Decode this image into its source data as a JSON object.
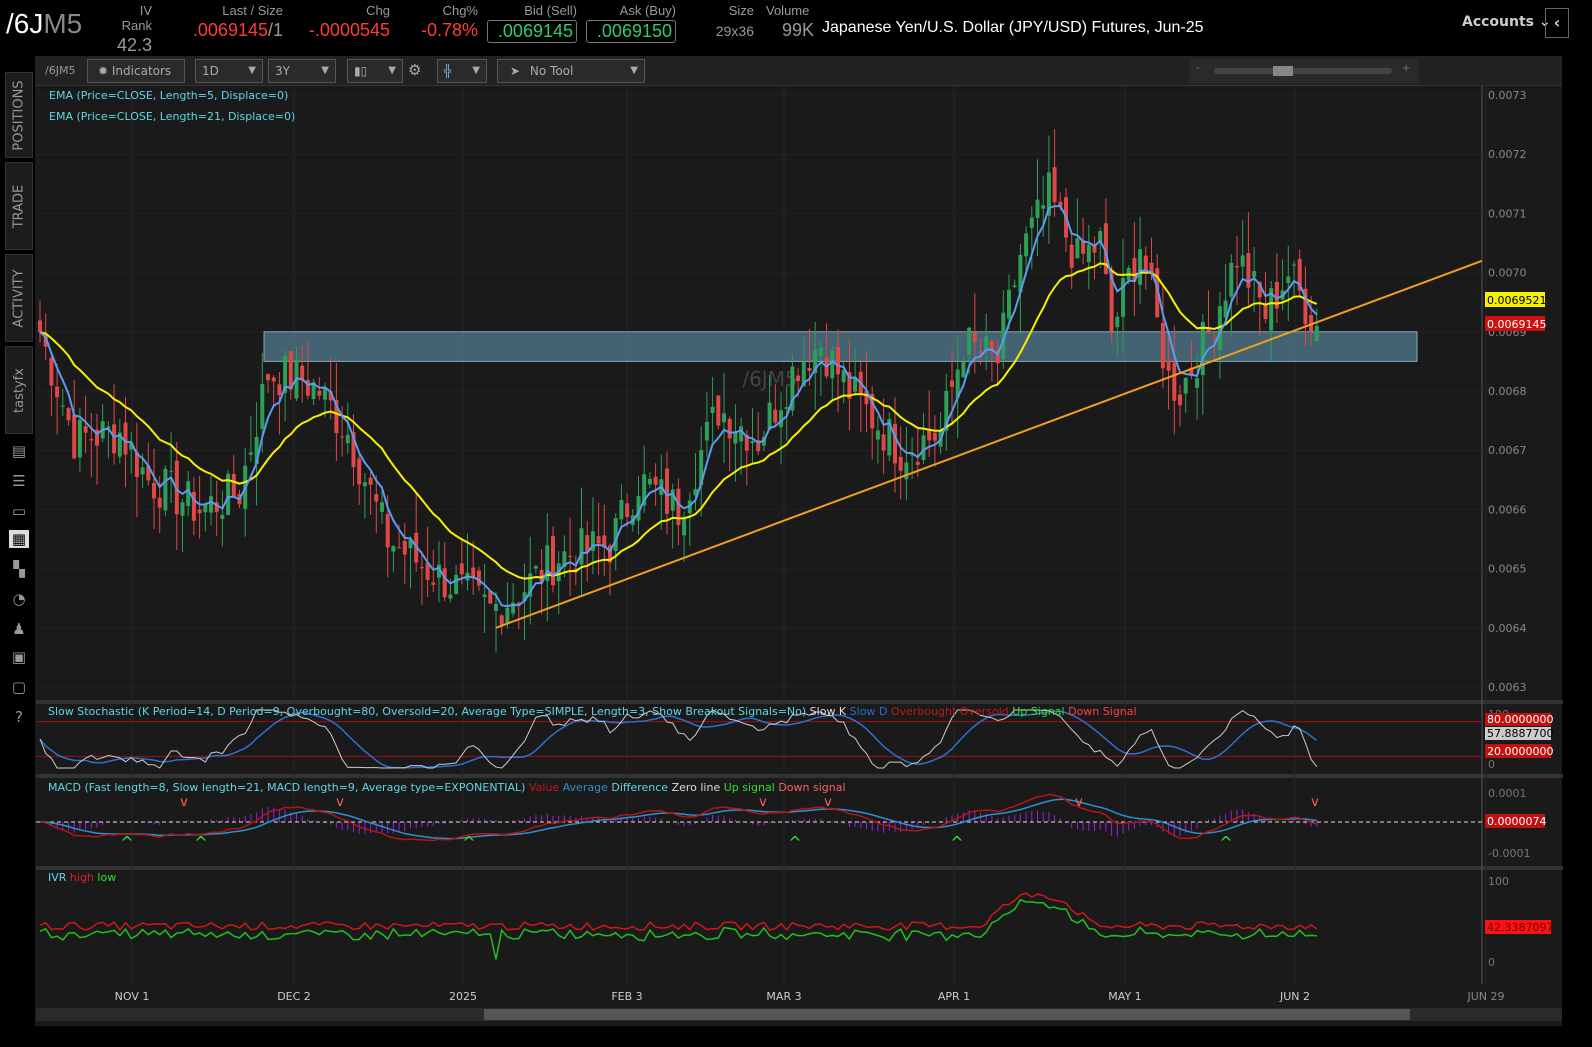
{
  "header": {
    "symbol_main": "/6J",
    "symbol_dim": "M5",
    "iv_rank": {
      "label": "IV Rank",
      "value": "42.3"
    },
    "last": {
      "label": "Last / Size",
      "value": ".0069145",
      "size": "/1"
    },
    "chg": {
      "label": "Chg",
      "value": "-.0000545"
    },
    "chgp": {
      "label": "Chg%",
      "value": "-0.78%"
    },
    "bid": {
      "label": "Bid (Sell)",
      "value": ".0069145"
    },
    "ask": {
      "label": "Ask (Buy)",
      "value": ".0069150"
    },
    "size": {
      "label": "Size",
      "value": "29x36"
    },
    "volume": {
      "label": "Volume",
      "value": "99K"
    },
    "description": "Japanese Yen/U.S. Dollar (JPY/USD) Futures, Jun-25",
    "accounts": "Accounts"
  },
  "sidebar": {
    "tabs": [
      "POSITIONS",
      "TRADE",
      "ACTIVITY",
      "tastyfx"
    ]
  },
  "toolbar": {
    "symbol": "/6JM5",
    "indicators": "Indicators",
    "aggregation": "1D",
    "range": "3Y",
    "tool": "No Tool"
  },
  "studies": {
    "ema5": "EMA (Price=CLOSE, Length=5, Displace=0)",
    "ema21": "EMA (Price=CLOSE, Length=21, Displace=0)",
    "stoch": {
      "title": "Slow Stochastic (K Period=14, D Period=9, Overbought=80, Oversold=20, Average Type=SIMPLE, Length=3, Show Breakout Signals=No)",
      "legend": [
        "Slow K",
        "Slow D",
        "Overbought",
        "Oversold",
        "Up Signal",
        "Down Signal"
      ],
      "k_value": "57.8887700",
      "ob_value": "80.0000000",
      "os_value": "20.0000000"
    },
    "macd": {
      "title": "MACD (Fast length=8, Slow length=21, MACD length=9, Average type=EXPONENTIAL)",
      "legend": [
        "Value",
        "Average",
        "Difference",
        "Zero line",
        "Up signal",
        "Down signal"
      ],
      "value": "0.0000074"
    },
    "ivr": {
      "title": "IVR",
      "legend": [
        "high",
        "low"
      ],
      "value": "42.3387097"
    }
  },
  "watermark": "/6JM5",
  "colors": {
    "up": "#2e9e58",
    "down": "#e04848",
    "ema5": "#5b9cf0",
    "ema21": "#f5f000",
    "trend": "#f0a020",
    "zone": "#5f93ad"
  },
  "chart_data": {
    "type": "candlestick",
    "price_ticks": [
      "0.0073",
      "0.0072",
      "0.0071",
      "0.0070",
      "0.0069",
      "0.0068",
      "0.0067",
      "0.0066",
      "0.0065",
      "0.0064",
      "0.0063"
    ],
    "ylim": [
      0.0063,
      0.0073
    ],
    "x_labels": [
      "NOV 1",
      "DEC 2",
      "2025",
      "FEB 3",
      "MAR 3",
      "APR 1",
      "MAY 1",
      "JUN 2",
      "JUN 29"
    ],
    "close_keyframes": [
      [
        0,
        0.0069
      ],
      [
        6,
        0.00672
      ],
      [
        14,
        0.00673
      ],
      [
        19,
        0.00665
      ],
      [
        28,
        0.0066
      ],
      [
        35,
        0.00663
      ],
      [
        40,
        0.00683
      ],
      [
        46,
        0.00682
      ],
      [
        49,
        0.0068
      ],
      [
        54,
        0.00673
      ],
      [
        61,
        0.00655
      ],
      [
        68,
        0.0065
      ],
      [
        79,
        0.00643
      ],
      [
        84,
        0.00646
      ],
      [
        91,
        0.00652
      ],
      [
        100,
        0.00654
      ],
      [
        105,
        0.00665
      ],
      [
        112,
        0.0066
      ],
      [
        119,
        0.00677
      ],
      [
        126,
        0.00672
      ],
      [
        133,
        0.00685
      ],
      [
        137,
        0.00688
      ],
      [
        142,
        0.0068
      ],
      [
        151,
        0.0067
      ],
      [
        158,
        0.00673
      ],
      [
        162,
        0.00688
      ],
      [
        168,
        0.00685
      ],
      [
        172,
        0.00703
      ],
      [
        177,
        0.00713
      ],
      [
        182,
        0.00702
      ],
      [
        186,
        0.00705
      ],
      [
        188,
        0.0069
      ],
      [
        193,
        0.00705
      ],
      [
        198,
        0.00682
      ],
      [
        200,
        0.0068
      ],
      [
        205,
        0.0069
      ],
      [
        210,
        0.00703
      ],
      [
        215,
        0.00693
      ],
      [
        219,
        0.007
      ],
      [
        224,
        0.00691
      ]
    ],
    "support_zone": [
      0.00685,
      0.0069
    ],
    "trendline": [
      [
        80,
        0.0064
      ],
      [
        253,
        0.00702
      ]
    ],
    "last_labels": {
      "ema21": "0.0069521",
      "last": "0.0069145"
    }
  }
}
